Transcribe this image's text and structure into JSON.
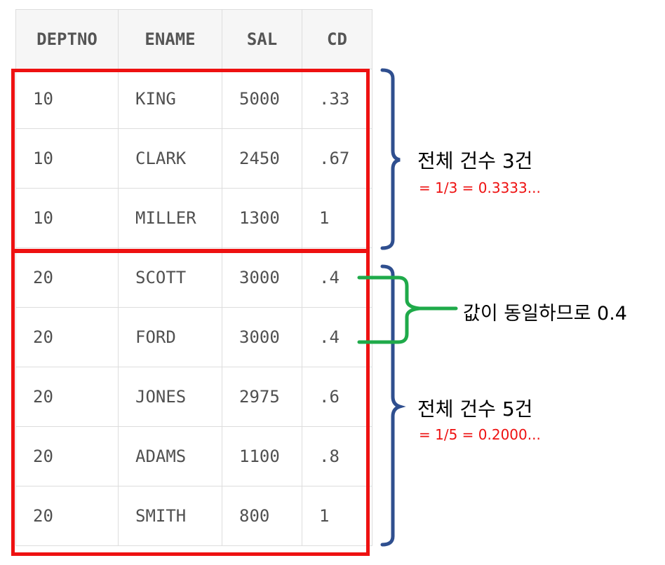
{
  "table": {
    "headers": [
      "DEPTNO",
      "ENAME",
      "SAL",
      "CD"
    ],
    "rows": [
      [
        "10",
        "KING",
        "5000",
        ".33"
      ],
      [
        "10",
        "CLARK",
        "2450",
        ".67"
      ],
      [
        "10",
        "MILLER",
        "1300",
        "1"
      ],
      [
        "20",
        "SCOTT",
        "3000",
        ".4"
      ],
      [
        "20",
        "FORD",
        "3000",
        ".4"
      ],
      [
        "20",
        "JONES",
        "2975",
        ".6"
      ],
      [
        "20",
        "ADAMS",
        "1100",
        ".8"
      ],
      [
        "20",
        "SMITH",
        "800",
        "1"
      ]
    ]
  },
  "annotations": {
    "group1_count": "전체 건수 3건",
    "group1_formula": "= 1/3 = 0.3333...",
    "tie_note": "값이 동일하므로 0.4",
    "group2_count": "전체 건수 5건",
    "group2_formula": "= 1/5 = 0.2000..."
  },
  "colors": {
    "group_box": "#ee1111",
    "brace_blue": "#2f4f8f",
    "brace_green": "#1faa4a",
    "formula_text": "#ee1111"
  }
}
